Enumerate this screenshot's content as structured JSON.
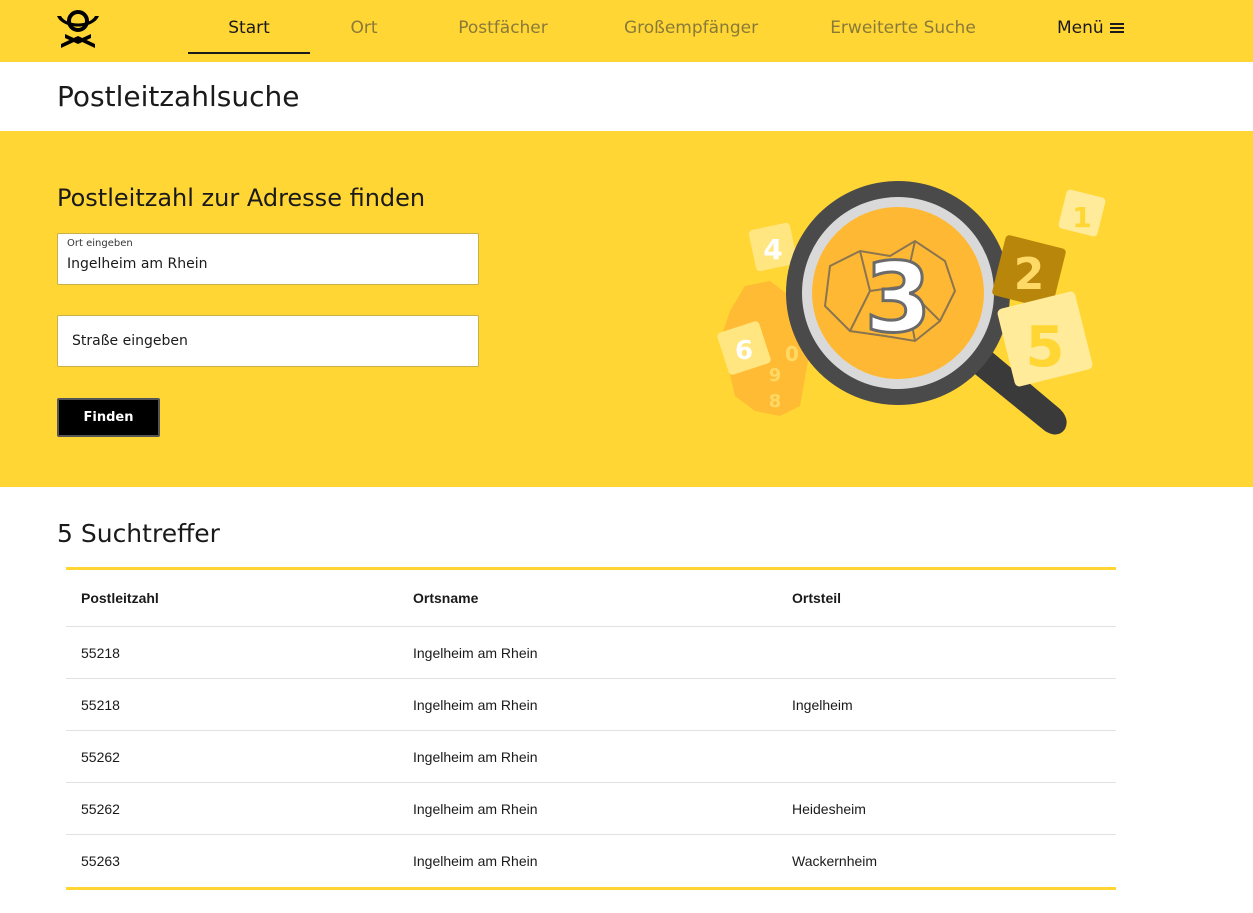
{
  "nav": {
    "items": [
      {
        "label": "Start",
        "active": true
      },
      {
        "label": "Ort",
        "active": false
      },
      {
        "label": "Postfächer",
        "active": false
      },
      {
        "label": "Großempfänger",
        "active": false
      },
      {
        "label": "Erweiterte Suche",
        "active": false
      }
    ],
    "menu_label": "Menü",
    "logo_icon": "posthorn-logo-icon"
  },
  "page": {
    "title": "Postleitzahlsuche"
  },
  "search": {
    "heading": "Postleitzahl zur Adresse finden",
    "city_label": "Ort eingeben",
    "city_value": "Ingelheim am Rhein",
    "street_placeholder": "Straße eingeben",
    "submit_label": "Finden"
  },
  "illustration": {
    "digits": [
      "4",
      "6",
      "0",
      "9",
      "8",
      "3",
      "2",
      "1",
      "5"
    ]
  },
  "results": {
    "heading": "5 Suchtreffer",
    "columns": [
      "Postleitzahl",
      "Ortsname",
      "Ortsteil"
    ],
    "rows": [
      [
        "55218",
        "Ingelheim am Rhein",
        ""
      ],
      [
        "55218",
        "Ingelheim am Rhein",
        "Ingelheim"
      ],
      [
        "55262",
        "Ingelheim am Rhein",
        ""
      ],
      [
        "55262",
        "Ingelheim am Rhein",
        "Heidesheim"
      ],
      [
        "55263",
        "Ingelheim am Rhein",
        "Wackernheim"
      ]
    ]
  },
  "colors": {
    "brand_yellow": "#ffd633",
    "text_dark": "#1a1a1a",
    "nav_inactive": "#8a7a3a",
    "button_bg": "#000000"
  }
}
